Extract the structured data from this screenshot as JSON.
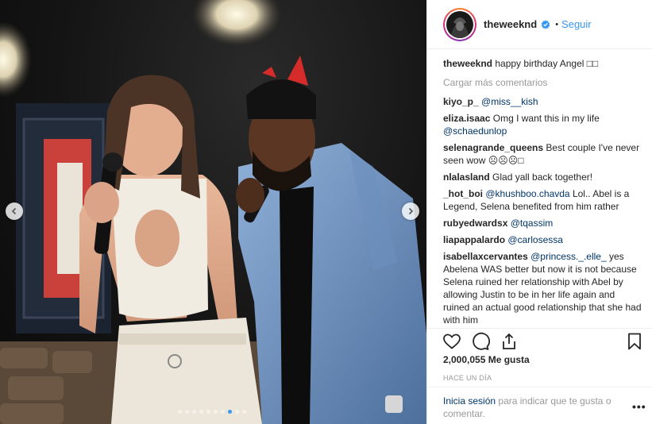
{
  "header": {
    "username": "theweeknd",
    "separator": "•",
    "follow_label": "Seguir",
    "verified_icon": "verified-badge-icon"
  },
  "caption": {
    "username": "theweeknd",
    "text": "happy birthday Angel □□"
  },
  "load_more_label": "Cargar más comentarios",
  "comments": [
    {
      "user": "kiyo_p_",
      "mention": "@miss__kish",
      "text": ""
    },
    {
      "user": "eliza.isaac",
      "mention": "",
      "text": "Omg I want this in my life",
      "mention_after": "@schaedunlop"
    },
    {
      "user": "selenagrande_queens",
      "mention": "",
      "text": "Best couple I've never seen wow ☹☹☹□"
    },
    {
      "user": "nlalasland",
      "mention": "",
      "text": "Glad yall back together!"
    },
    {
      "user": "_hot_boi",
      "mention": "@khushboo.chavda",
      "text": "Lol.. Abel is a Legend, Selena benefited from him rather"
    },
    {
      "user": "rubyedwardsx",
      "mention": "@tqassim",
      "text": ""
    },
    {
      "user": "liapappalardo",
      "mention": "@carlosessa",
      "text": ""
    },
    {
      "user": "isabellaxcervantes",
      "mention": "@princess._.elle_",
      "text": "yes Abelena WAS better but now it is not because Selena ruined her relationship with Abel by allowing Justin to be in her life again and ruined an actual good relationship that she had with him"
    }
  ],
  "likes": "2,000,055 Me gusta",
  "timestamp": "HACE UN DÍA",
  "login": {
    "link": "Inicia sesión",
    "text": "para indicar que te gusta o comentar."
  },
  "more_options": "•••",
  "carousel": {
    "total_dots": 10,
    "active_index": 7,
    "accent": "#3897f0"
  },
  "colors": {
    "link_blue": "#3897f0",
    "mention_blue": "#003569",
    "muted_gray": "#999999",
    "text": "#262626"
  },
  "icons": [
    "heart-icon",
    "comment-icon",
    "share-icon",
    "bookmark-icon",
    "chevron-left-icon",
    "chevron-right-icon"
  ]
}
